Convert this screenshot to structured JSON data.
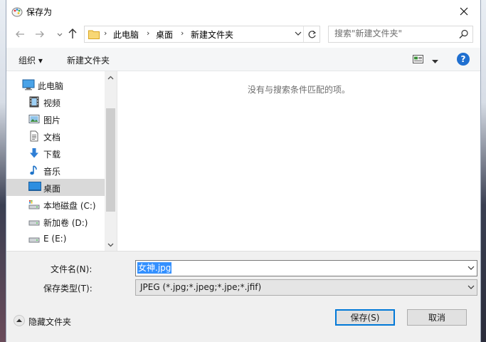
{
  "window": {
    "title": "保存为",
    "close": "✕"
  },
  "navigation": {
    "back": "←",
    "forward": "→",
    "up": "↑"
  },
  "address": {
    "crumbs": [
      "此电脑",
      "桌面",
      "新建文件夹"
    ],
    "separator": "›"
  },
  "search": {
    "placeholder": "搜索\"新建文件夹\""
  },
  "toolbar": {
    "organize": "组织 ▾",
    "new_folder": "新建文件夹",
    "help": "?"
  },
  "nav_pane": {
    "root": "此电脑",
    "items": [
      "视频",
      "图片",
      "文档",
      "下载",
      "音乐",
      "桌面",
      "本地磁盘 (C:)",
      "新加卷 (D:)",
      "E (E:)"
    ],
    "selected": "桌面"
  },
  "file_pane": {
    "empty_message": "没有与搜索条件匹配的项。"
  },
  "form": {
    "filename_label": "文件名(N):",
    "filename_value": "女神.jpg",
    "filetype_label": "保存类型(T):",
    "filetype_value": "JPEG (*.jpg;*.jpeg;*.jpe;*.jfif)"
  },
  "footer": {
    "hide_folders": "隐藏文件夹",
    "save": "保存(S)",
    "cancel": "取消"
  }
}
